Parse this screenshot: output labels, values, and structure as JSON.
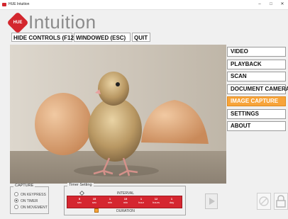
{
  "window": {
    "title": "HUE Intuition",
    "minimize_glyph": "–",
    "maximize_glyph": "□",
    "close_glyph": "✕"
  },
  "logo": {
    "badge": "HUE",
    "text": "Intuition",
    "badge_color": "#d3272e"
  },
  "top_controls": {
    "hide_controls": "HIDE CONTROLS (F12)",
    "windowed": "WINDOWED (ESC)",
    "quit": "QUIT"
  },
  "preview": {
    "subject": "chick-with-eggshells-image"
  },
  "menu": {
    "items": [
      {
        "label": "VIDEO",
        "active": false
      },
      {
        "label": "PLAYBACK",
        "active": false
      },
      {
        "label": "SCAN",
        "active": false
      },
      {
        "label": "DOCUMENT CAMERA",
        "active": false
      },
      {
        "label": "IMAGE CAPTURE",
        "active": true
      },
      {
        "label": "SETTINGS",
        "active": false
      },
      {
        "label": "ABOUT",
        "active": false
      }
    ],
    "active_color": "#f7a43a"
  },
  "capture": {
    "legend": "CAPTURE",
    "options": [
      {
        "label": "ON KEYPRESS",
        "checked": false
      },
      {
        "label": "ON TIMER",
        "checked": true
      },
      {
        "label": "ON MOVEMENT",
        "checked": false
      }
    ]
  },
  "timer": {
    "legend": "Timer Setting",
    "interval_label": "INTERVAL",
    "duration_label": "DURATION",
    "ticks": [
      {
        "value": "5",
        "unit": "sec"
      },
      {
        "value": "15",
        "unit": "sec"
      },
      {
        "value": "1",
        "unit": "min"
      },
      {
        "value": "15",
        "unit": "min"
      },
      {
        "value": "1",
        "unit": "hour"
      },
      {
        "value": "12",
        "unit": "hours"
      },
      {
        "value": "1",
        "unit": "day"
      }
    ],
    "scale_color": "#d52630"
  },
  "bottom_icons": {
    "play": "play-icon",
    "disabled": "disabled-icon",
    "lock": "lock-icon"
  }
}
